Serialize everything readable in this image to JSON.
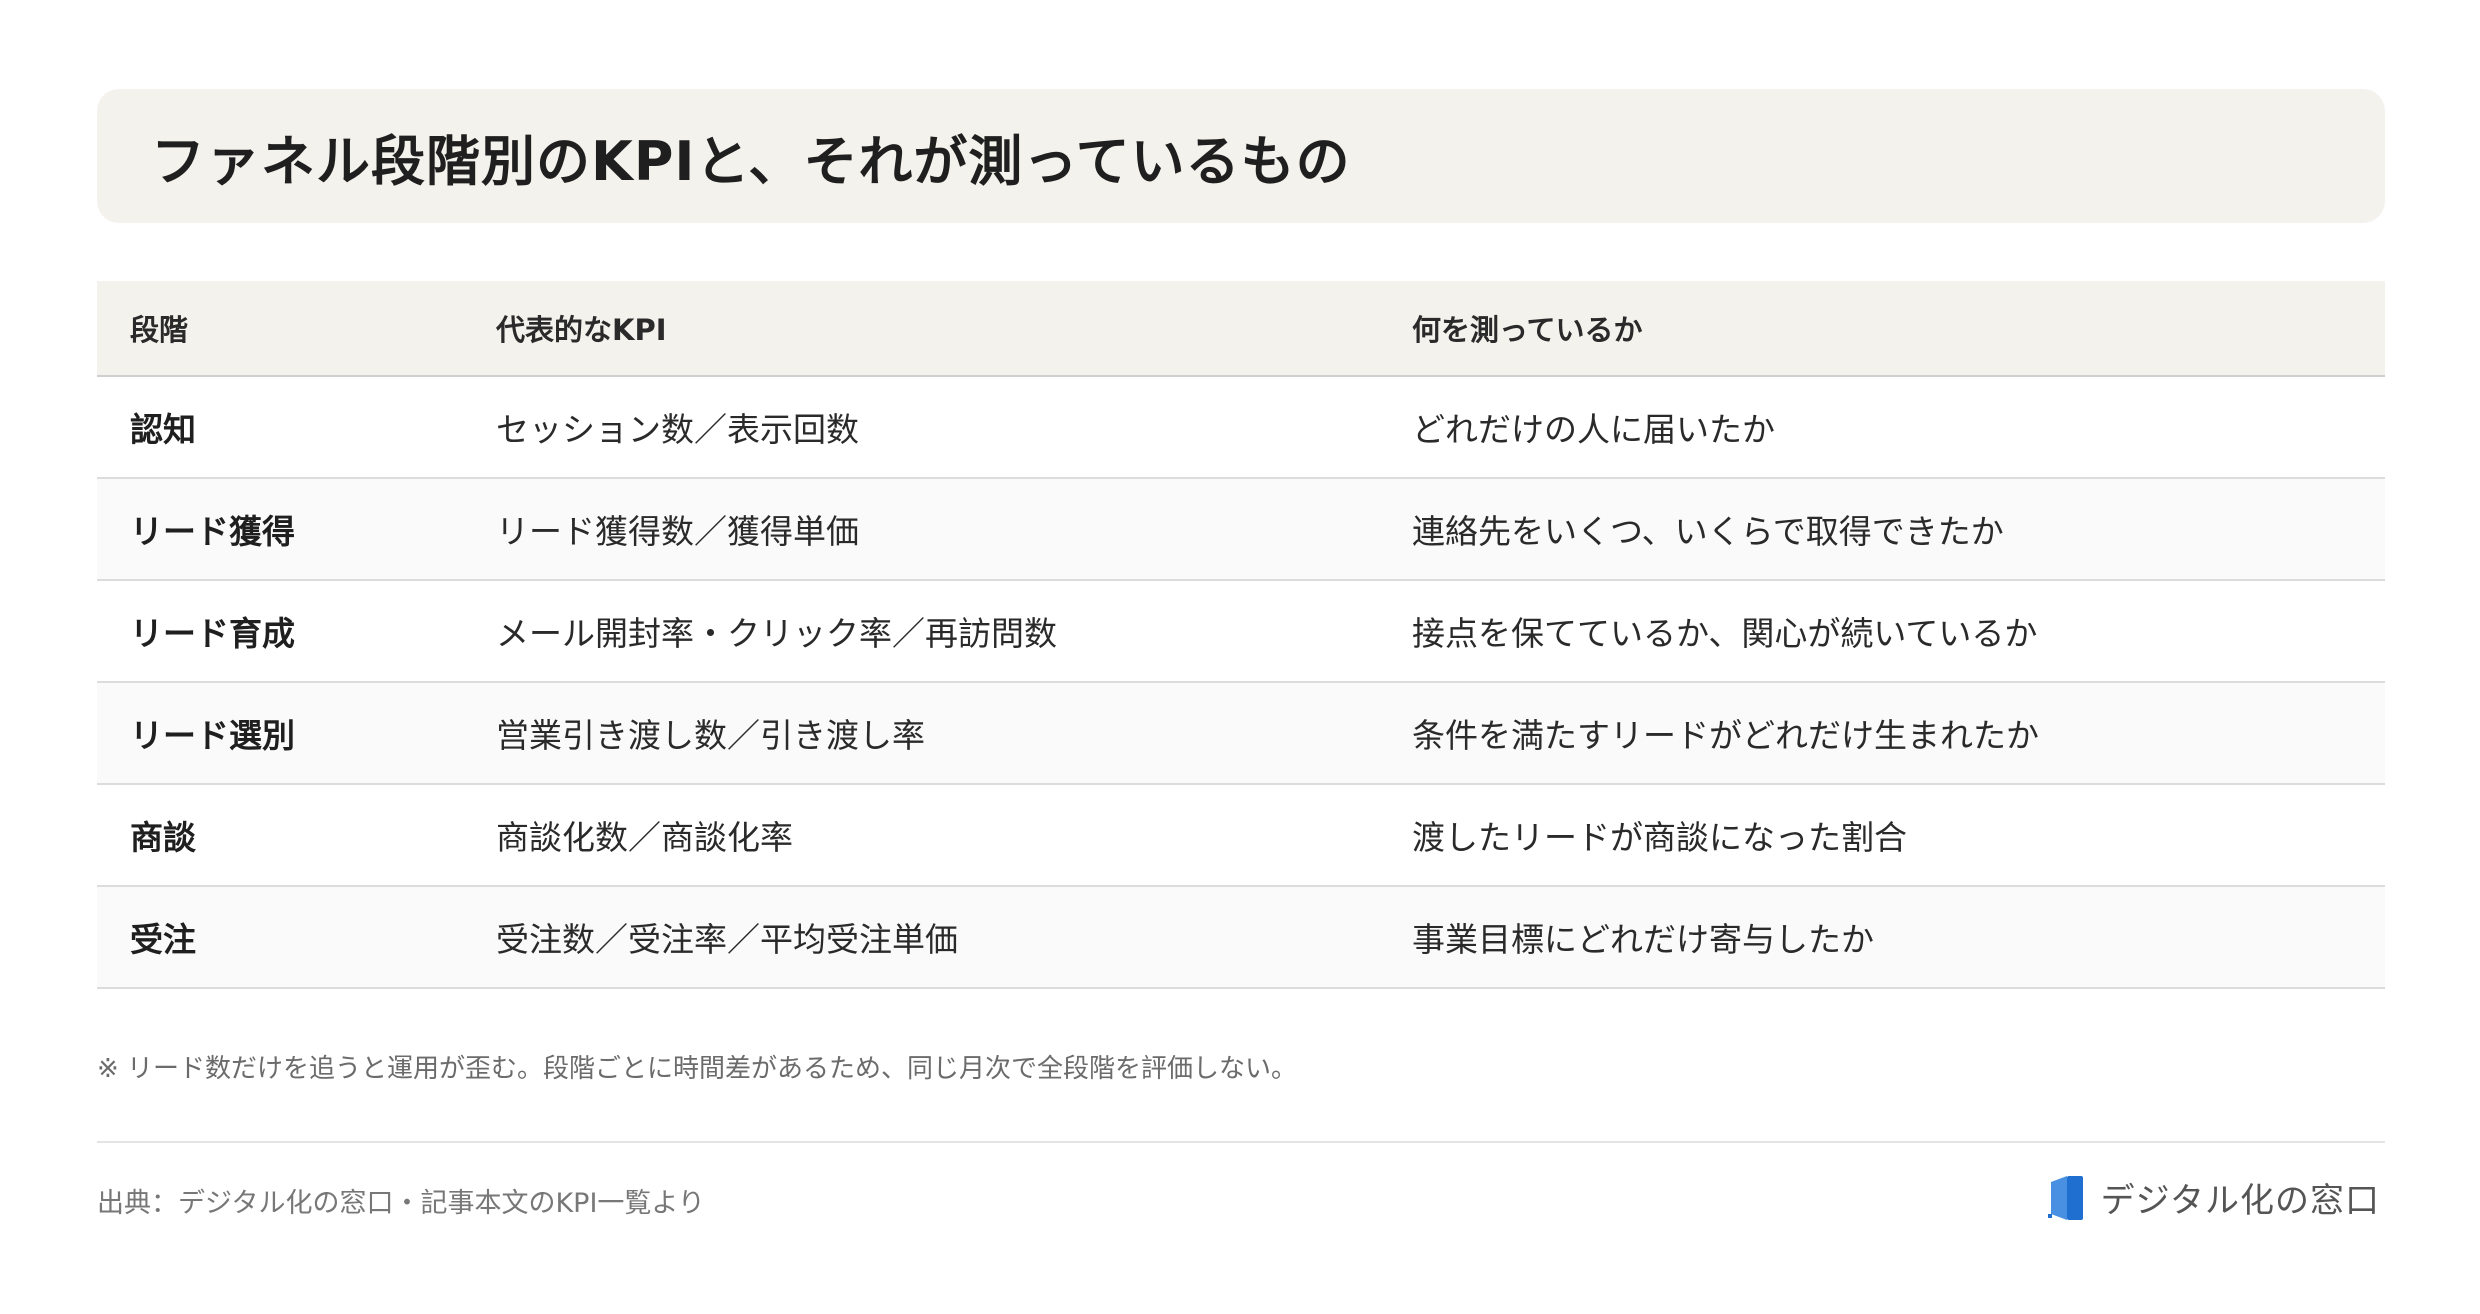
{
  "title": "ファネル段階別のKPIと、それが測っているもの",
  "table": {
    "headers": [
      "段階",
      "代表的なKPI",
      "何を測っているか"
    ],
    "rows": [
      {
        "stage": "認知",
        "kpi": "セッション数／表示回数",
        "measures": "どれだけの人に届いたか"
      },
      {
        "stage": "リード獲得",
        "kpi": "リード獲得数／獲得単価",
        "measures": "連絡先をいくつ、いくらで取得できたか"
      },
      {
        "stage": "リード育成",
        "kpi": "メール開封率・クリック率／再訪問数",
        "measures": "接点を保てているか、関心が続いているか"
      },
      {
        "stage": "リード選別",
        "kpi": "営業引き渡し数／引き渡し率",
        "measures": "条件を満たすリードがどれだけ生まれたか"
      },
      {
        "stage": "商談",
        "kpi": "商談化数／商談化率",
        "measures": "渡したリードが商談になった割合"
      },
      {
        "stage": "受注",
        "kpi": "受注数／受注率／平均受注単価",
        "measures": "事業目標にどれだけ寄与したか"
      }
    ]
  },
  "note": "※ リード数だけを追うと運用が歪む。段階ごとに時間差があるため、同じ月次で全段階を評価しない。",
  "source": "出典：デジタル化の窓口・記事本文のKPI一覧より",
  "brand": {
    "name": "デジタル化の窓口",
    "icon": "book-logo-icon",
    "accent_color": "#1f6fd1"
  }
}
